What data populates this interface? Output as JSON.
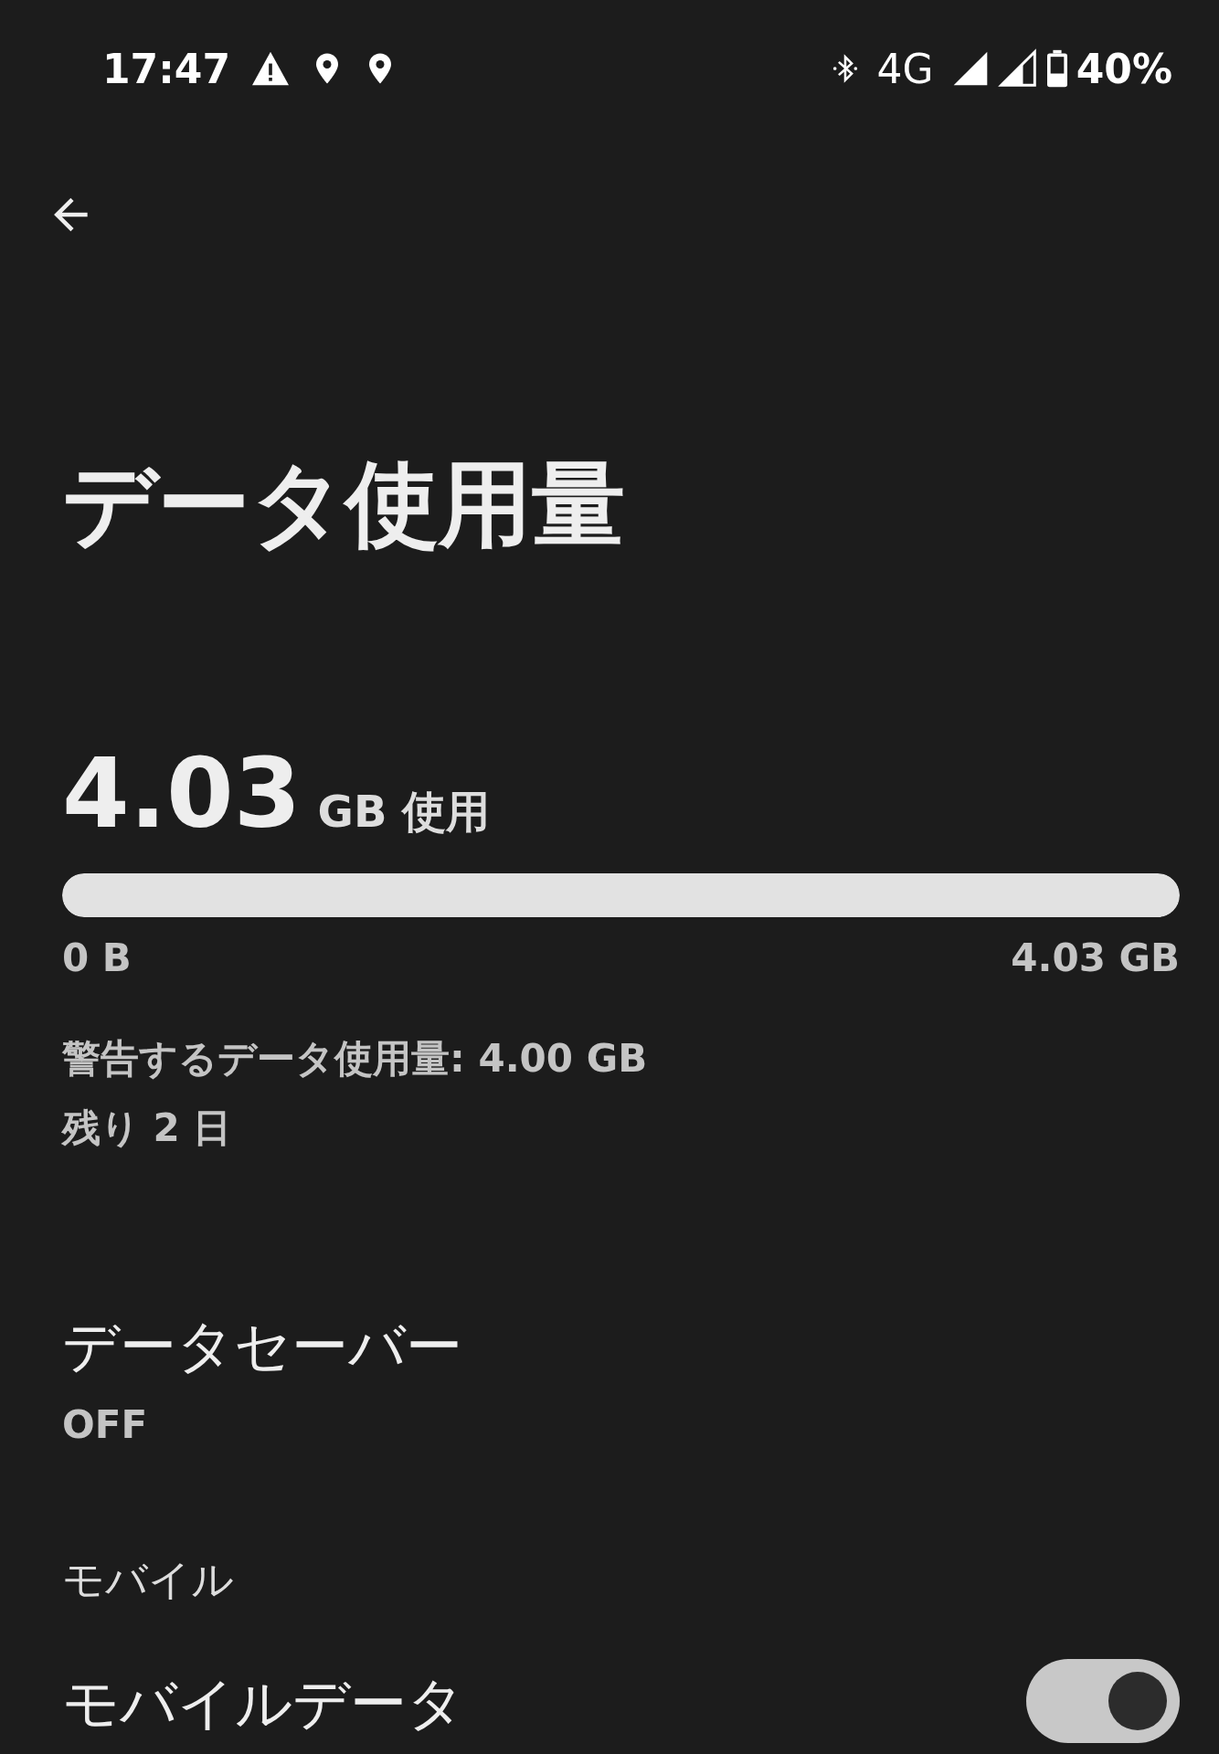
{
  "status_bar": {
    "time": "17:47",
    "network": "4G",
    "battery": "40%"
  },
  "page": {
    "title": "データ使用量"
  },
  "usage": {
    "amount": "4.03",
    "unit": "GB 使用",
    "level": 1,
    "min_label": "0 B",
    "max_label": "4.03 GB",
    "warning": "警告するデータ使用量: 4.00 GB",
    "remaining": "残り 2 日"
  },
  "data_saver": {
    "title": "データセーバー",
    "state": "OFF"
  },
  "sections": [
    {
      "header": "モバイル",
      "items": [
        {
          "title": "モバイルデータ",
          "on": true
        }
      ]
    }
  ]
}
